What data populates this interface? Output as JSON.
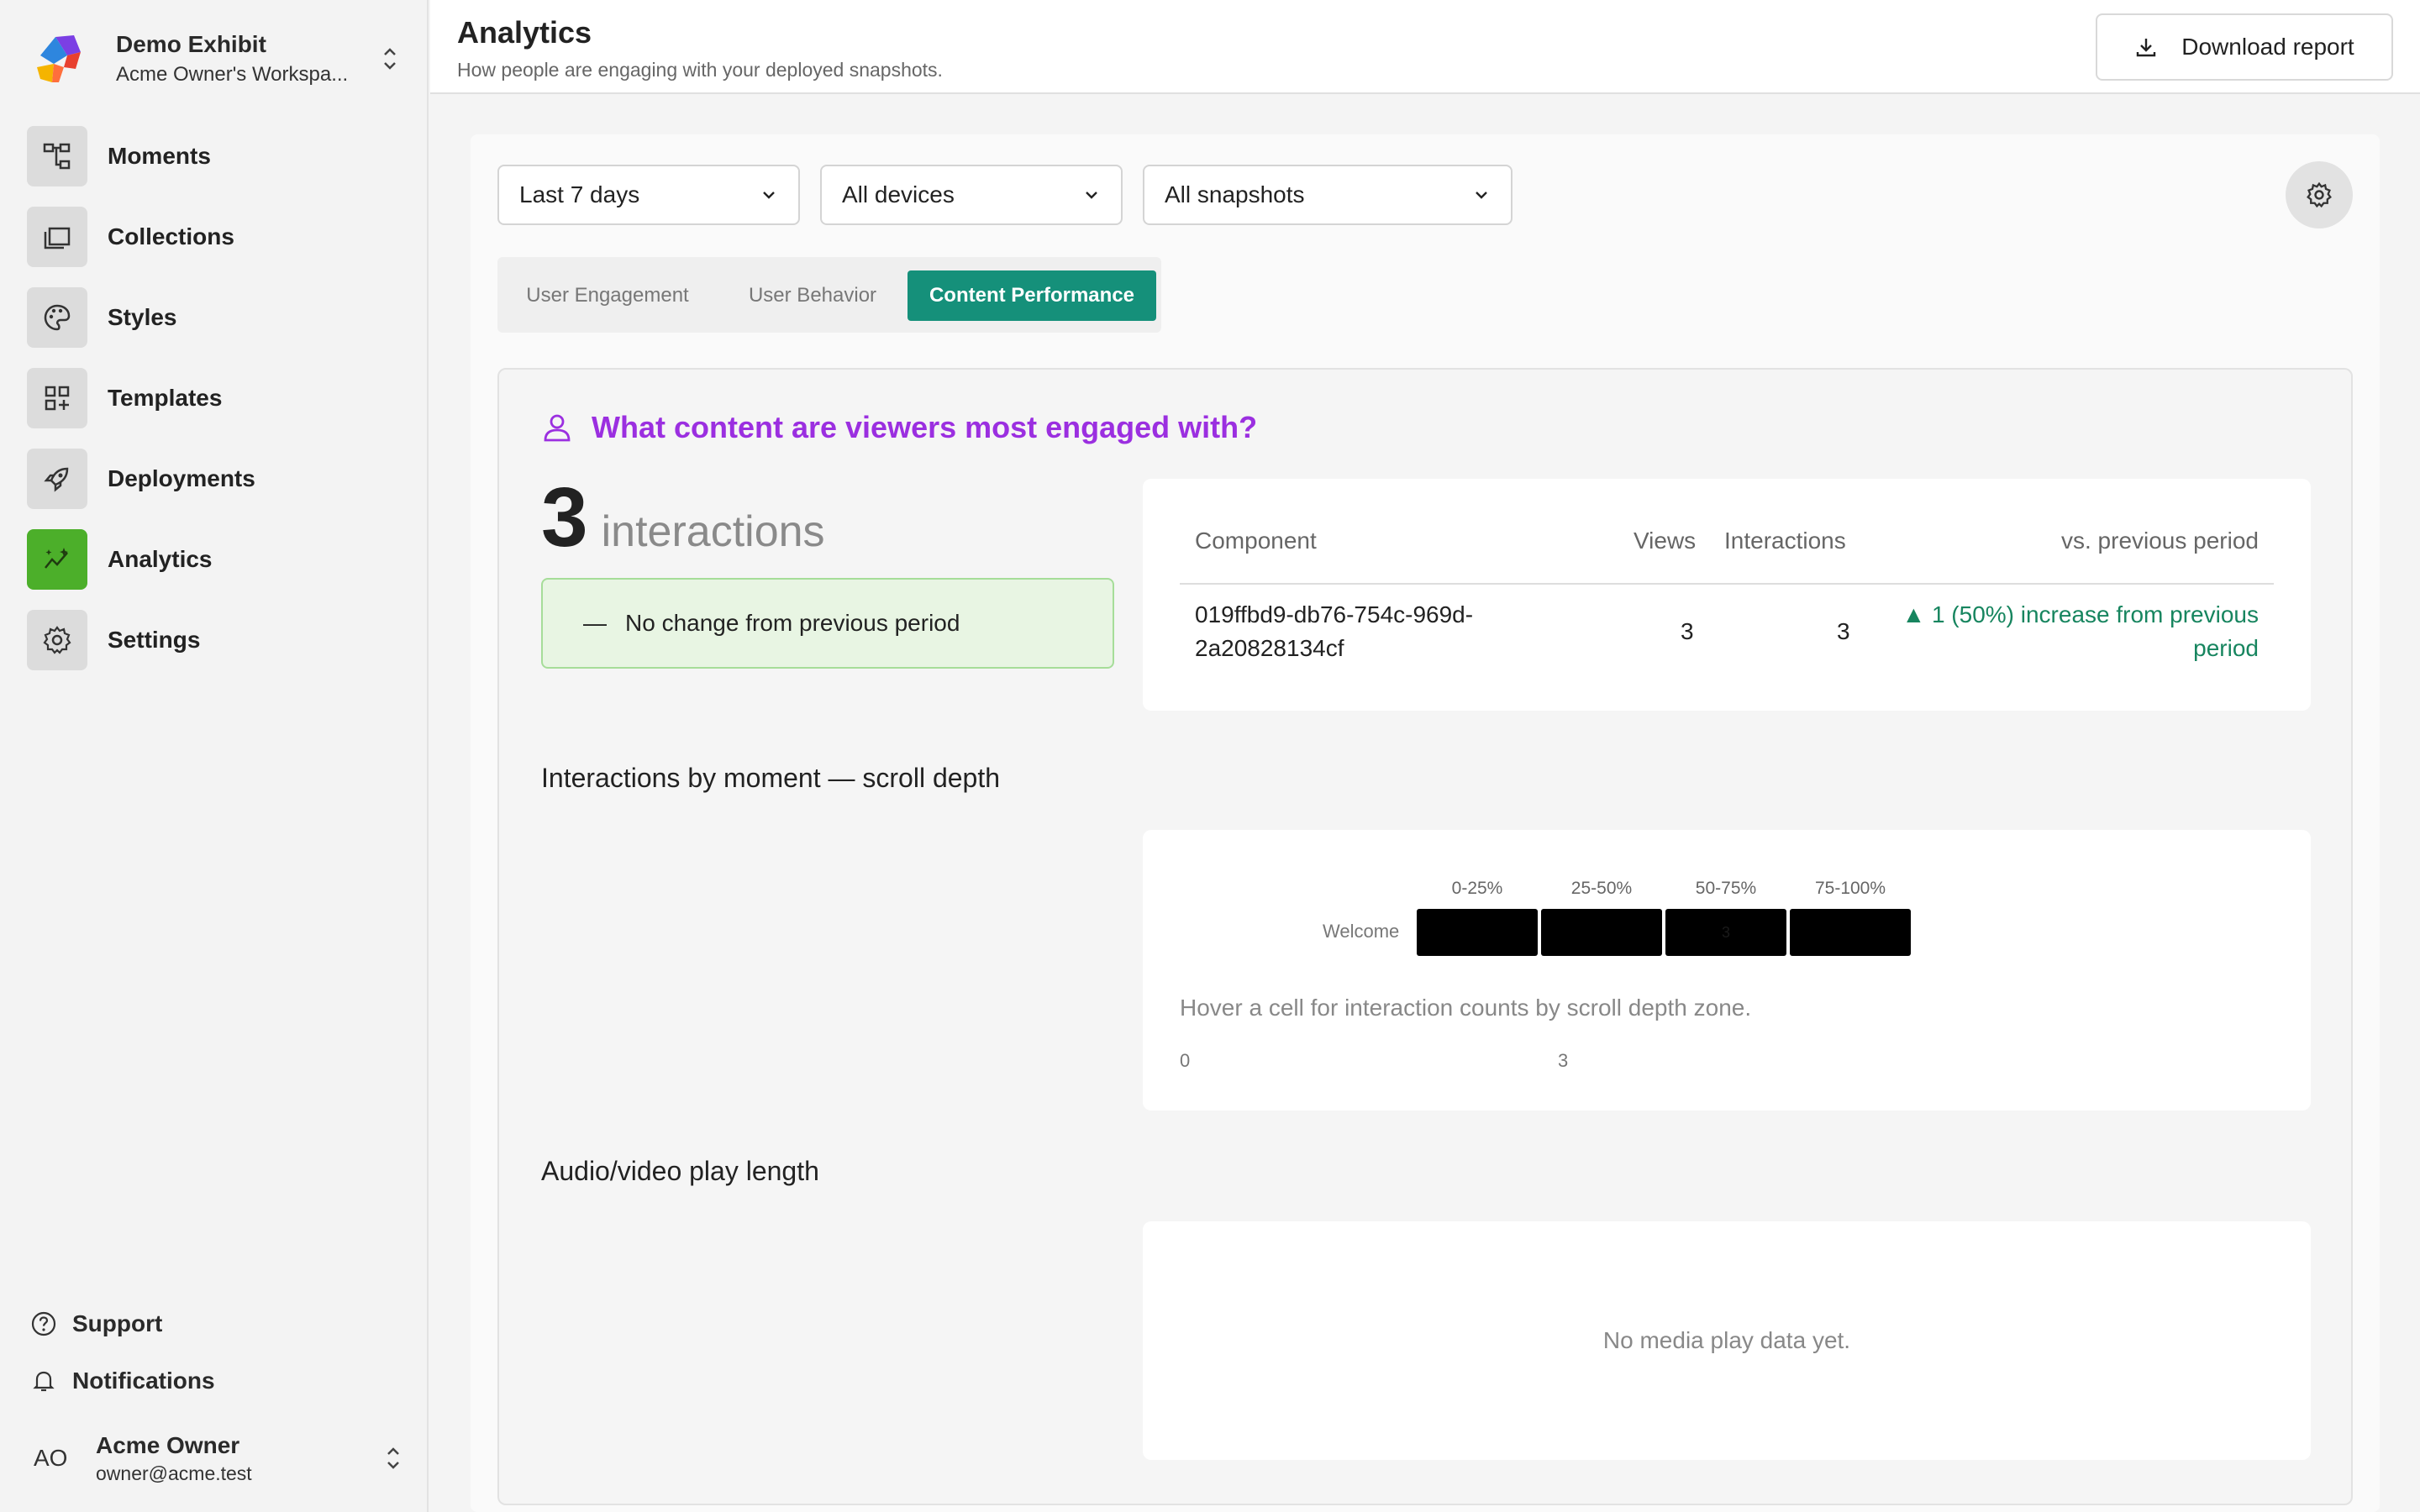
{
  "workspace": {
    "name": "Demo Exhibit",
    "sub": "Acme Owner's Workspa..."
  },
  "nav": [
    {
      "label": "Moments",
      "icon": "hierarchy-icon"
    },
    {
      "label": "Collections",
      "icon": "folders-icon"
    },
    {
      "label": "Styles",
      "icon": "palette-icon"
    },
    {
      "label": "Templates",
      "icon": "grid-plus-icon"
    },
    {
      "label": "Deployments",
      "icon": "rocket-icon"
    },
    {
      "label": "Analytics",
      "icon": "sparkle-chart-icon",
      "active": true
    },
    {
      "label": "Settings",
      "icon": "gear-icon"
    }
  ],
  "bottom": {
    "support": "Support",
    "notifications": "Notifications"
  },
  "user": {
    "initials": "AO",
    "name": "Acme Owner",
    "email": "owner@acme.test"
  },
  "header": {
    "title": "Analytics",
    "subtitle": "How people are engaging with your deployed snapshots.",
    "download": "Download report"
  },
  "filters": {
    "range": "Last 7 days",
    "devices": "All devices",
    "snapshots": "All snapshots"
  },
  "tabs": {
    "engagement": "User Engagement",
    "behavior": "User Behavior",
    "content": "Content Performance",
    "active": "Content Performance"
  },
  "card": {
    "question": "What content are viewers most engaged with?",
    "total": "3",
    "total_label": "interactions",
    "change_dash": "—",
    "change": "No change from previous period",
    "table": {
      "headers": {
        "component": "Component",
        "views": "Views",
        "interactions": "Interactions",
        "vs": "vs. previous period"
      },
      "rows": [
        {
          "component_l1": "019ffbd9-db76-754c-969d-",
          "component_l2": "2a20828134cf",
          "views": "3",
          "interactions": "3",
          "vs_l1": "▲ 1 (50%) increase from previous",
          "vs_l2": "period"
        }
      ]
    },
    "heatmap_title": "Interactions by moment — scroll depth",
    "heatmap": {
      "zones": [
        "0-25%",
        "25-50%",
        "50-75%",
        "75-100%"
      ],
      "rows": [
        {
          "label": "Welcome",
          "cells": [
            "",
            "",
            "3",
            ""
          ]
        }
      ],
      "hint": "Hover a cell for interaction counts by scroll depth zone.",
      "scale_min": "0",
      "scale_max": "3"
    },
    "media_title": "Audio/video play length",
    "media_empty": "No media play data yet."
  },
  "colors": {
    "accent_tab": "#15907a",
    "analytics_active": "#4caf2a",
    "question": "#9b2fe0",
    "increase": "#17855f"
  }
}
